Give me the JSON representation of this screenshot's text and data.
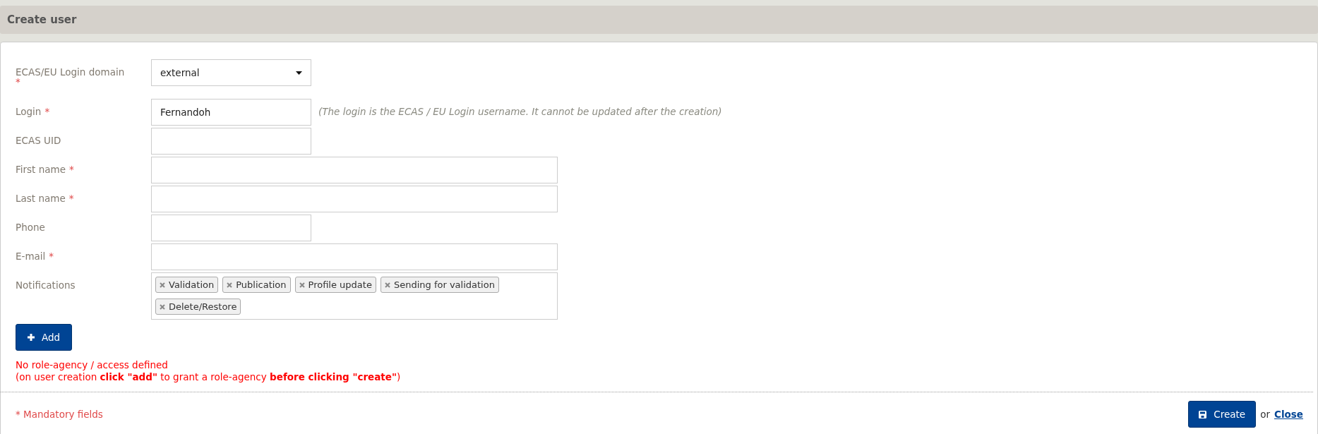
{
  "header": {
    "title": "Create user"
  },
  "fields": [
    {
      "kind": "select",
      "label": "ECAS/EU Login domain",
      "required": true,
      "wide": false,
      "value": "external"
    },
    {
      "kind": "text",
      "label": "Login",
      "required": true,
      "wide": false,
      "value": "Fernandoh",
      "hint": "(The login is the ECAS / EU Login username. It cannot be updated after the creation)"
    },
    {
      "kind": "text",
      "label": "ECAS UID",
      "required": false,
      "wide": false
    },
    {
      "kind": "text",
      "label": "First name",
      "required": true,
      "wide": true
    },
    {
      "kind": "text",
      "label": "Last name",
      "required": true,
      "wide": true
    },
    {
      "kind": "text",
      "label": "Phone",
      "required": false,
      "wide": false
    },
    {
      "kind": "text",
      "label": "E-mail",
      "required": true,
      "wide": true
    },
    {
      "kind": "tags",
      "label": "Notifications",
      "required": false,
      "wide": true,
      "tags": [
        "Validation",
        "Publication",
        "Profile update",
        "Sending for validation",
        "Delete/Restore"
      ]
    }
  ],
  "required_mark": "*",
  "add_button": "Add",
  "warning": [
    "No role-agency / access defined",
    "(on user creation **click \"add\"** to grant a role-agency **before clicking \"create\"**)"
  ],
  "footer": {
    "mandatory": "* Mandatory fields",
    "create_button": "Create",
    "or": "or",
    "close_link": "Close"
  }
}
